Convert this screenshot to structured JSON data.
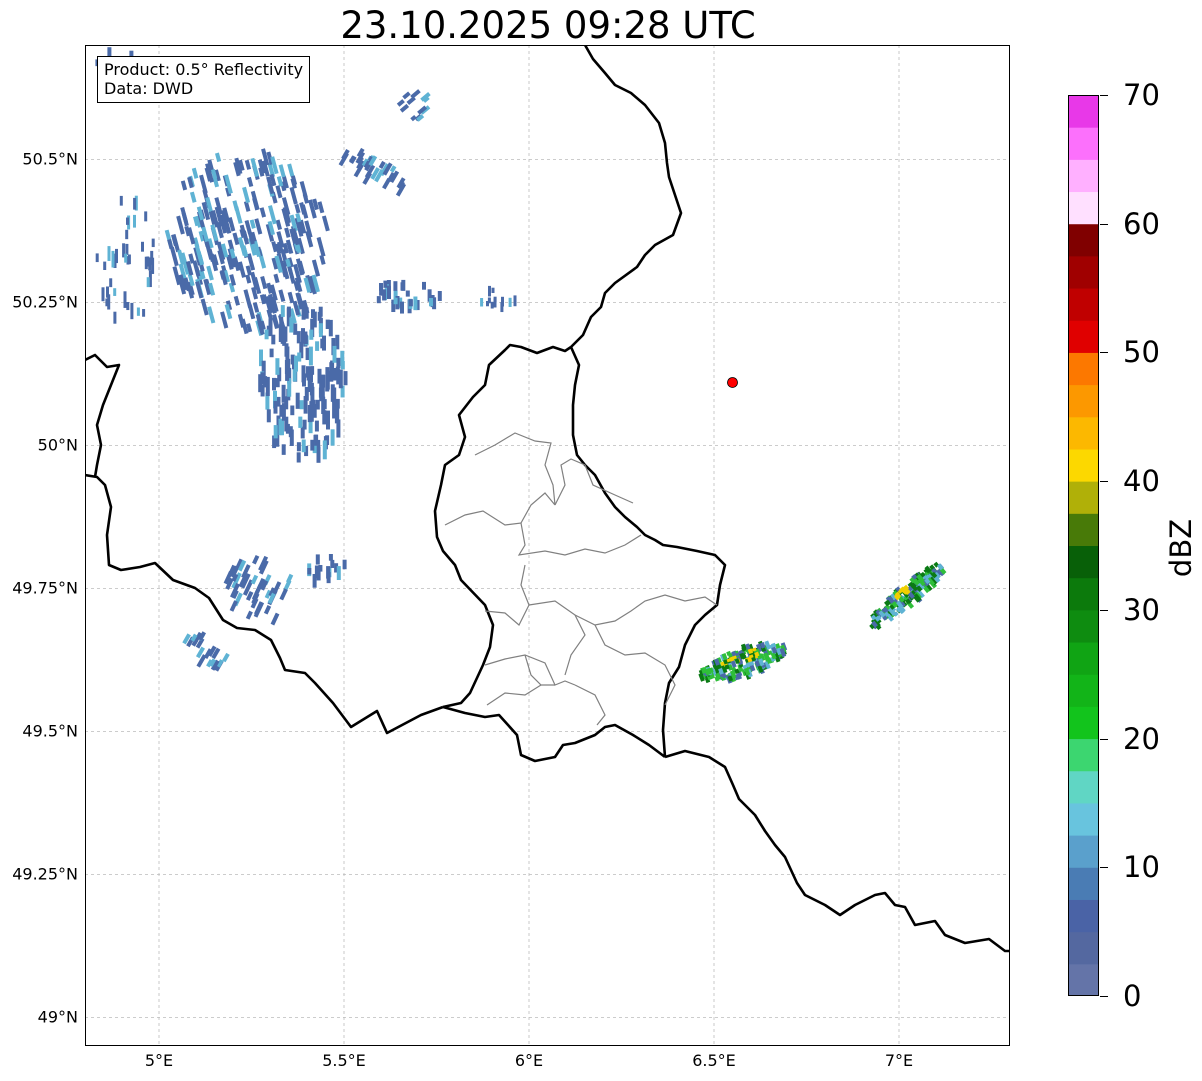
{
  "title": "23.10.2025 09:28 UTC",
  "info_box": {
    "product": "Product: 0.5° Reflectivity",
    "source": "Data: DWD"
  },
  "map": {
    "extent_lon": [
      4.8,
      7.3
    ],
    "extent_lat": [
      48.95,
      50.7
    ],
    "lat_ticks": [
      {
        "value": 50.5,
        "label": "50.5°N"
      },
      {
        "value": 50.25,
        "label": "50.25°N"
      },
      {
        "value": 50.0,
        "label": "50°N"
      },
      {
        "value": 49.75,
        "label": "49.75°N"
      },
      {
        "value": 49.5,
        "label": "49.5°N"
      },
      {
        "value": 49.25,
        "label": "49.25°N"
      },
      {
        "value": 49.0,
        "label": "49°N"
      }
    ],
    "lon_ticks": [
      {
        "value": 5.0,
        "label": "5°E"
      },
      {
        "value": 5.5,
        "label": "5.5°E"
      },
      {
        "value": 6.0,
        "label": "6°E"
      },
      {
        "value": 6.5,
        "label": "6.5°E"
      },
      {
        "value": 7.0,
        "label": "7°E"
      }
    ],
    "gridlines": true,
    "radar_site": {
      "lon": 6.55,
      "lat": 50.11,
      "color": "#ff0000"
    },
    "echo_colors": {
      "weak": "#4a6aa8",
      "light": "#5fb3d4",
      "moderate": "#2fbf3a",
      "strong": "#0a7a14",
      "core": "#f0d000"
    }
  },
  "colorbar": {
    "label": "dBZ",
    "min": 0,
    "max": 70,
    "ticks": [
      {
        "value": 0,
        "label": "0"
      },
      {
        "value": 10,
        "label": "10"
      },
      {
        "value": 20,
        "label": "20"
      },
      {
        "value": 30,
        "label": "30"
      },
      {
        "value": 40,
        "label": "40"
      },
      {
        "value": 50,
        "label": "50"
      },
      {
        "value": 60,
        "label": "60"
      },
      {
        "value": 70,
        "label": "70"
      }
    ],
    "colors": [
      "#6474a8",
      "#5468a0",
      "#4a63a6",
      "#4a7cb4",
      "#5aa0cc",
      "#68c4de",
      "#60d6c4",
      "#3cd670",
      "#12c41c",
      "#12b418",
      "#10a414",
      "#0e8c10",
      "#0c7a0c",
      "#086008",
      "#487a08",
      "#b0b008",
      "#fcd800",
      "#fcb800",
      "#fc9800",
      "#fc7800",
      "#e00000",
      "#c00000",
      "#a00000",
      "#800000",
      "#ffe0ff",
      "#ffb0ff",
      "#fc70fc",
      "#e838e8"
    ]
  }
}
